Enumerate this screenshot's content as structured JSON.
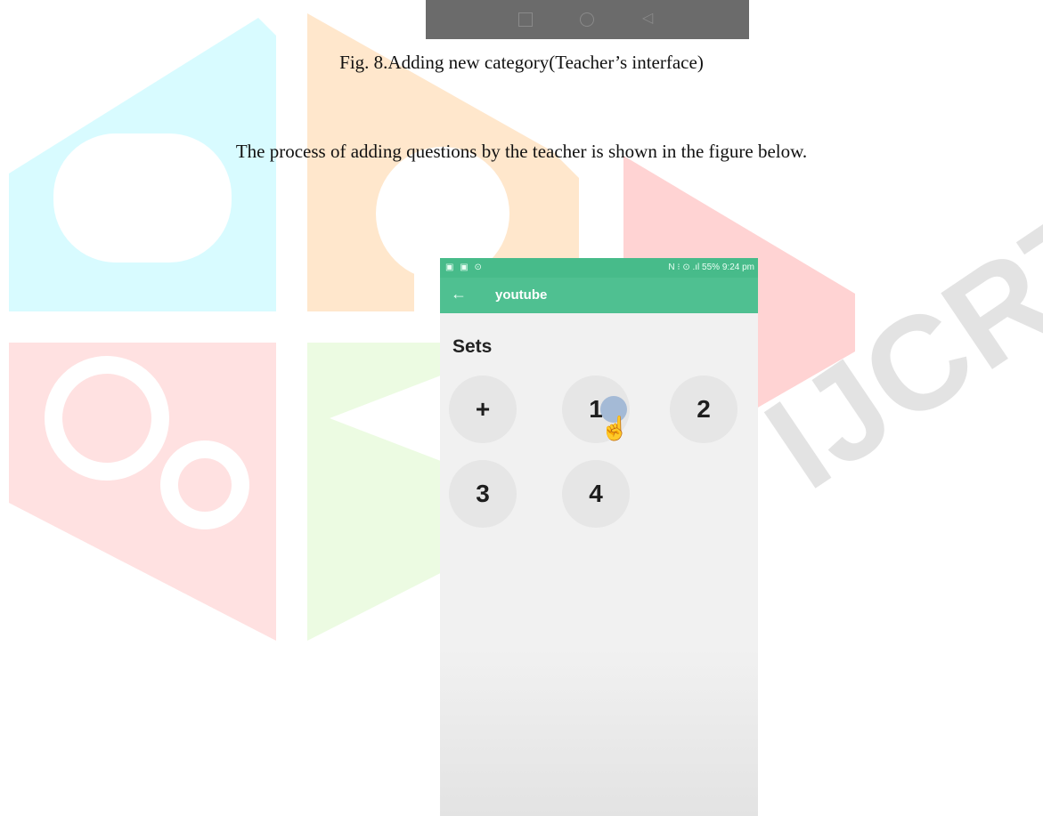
{
  "caption": "Fig. 8.Adding new category(Teacher’s interface)",
  "paragraph": "The process of adding questions by the teacher is shown in the figure below.",
  "watermark": {
    "text": "IJCRT"
  },
  "phone": {
    "status_left": "▣ ▣ ⊙",
    "status_right": "N ⁝ ⊙ .ıl 55% 9:24 pm",
    "title": "youtube",
    "back_icon": "back-arrow-icon",
    "sets_label": "Sets",
    "set_buttons": [
      "+",
      "1",
      "2",
      "3",
      "4"
    ],
    "colors": {
      "status_bar": "#47bb8a",
      "toolbar": "#4fc091",
      "button": "#e6e6e6"
    }
  },
  "prev_navbar": {
    "icons": [
      "recent-apps-icon",
      "home-icon",
      "back-icon"
    ]
  }
}
